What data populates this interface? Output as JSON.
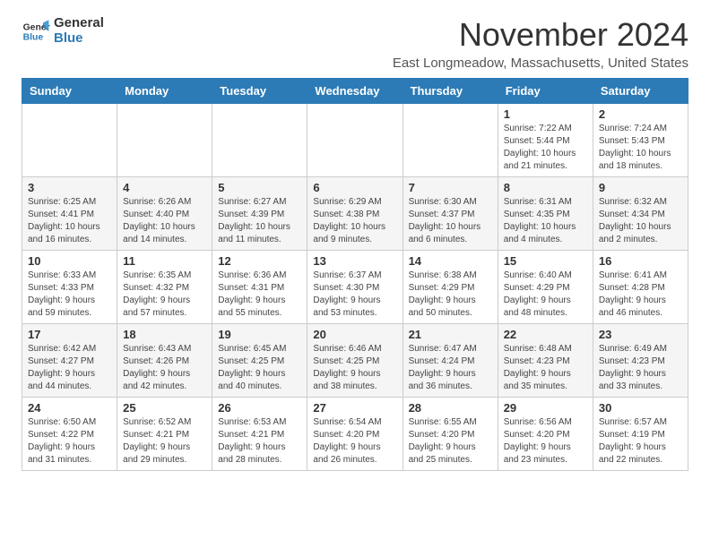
{
  "header": {
    "logo_general": "General",
    "logo_blue": "Blue",
    "month_title": "November 2024",
    "location": "East Longmeadow, Massachusetts, United States"
  },
  "days_of_week": [
    "Sunday",
    "Monday",
    "Tuesday",
    "Wednesday",
    "Thursday",
    "Friday",
    "Saturday"
  ],
  "weeks": [
    [
      {
        "num": "",
        "info": ""
      },
      {
        "num": "",
        "info": ""
      },
      {
        "num": "",
        "info": ""
      },
      {
        "num": "",
        "info": ""
      },
      {
        "num": "",
        "info": ""
      },
      {
        "num": "1",
        "info": "Sunrise: 7:22 AM\nSunset: 5:44 PM\nDaylight: 10 hours and 21 minutes."
      },
      {
        "num": "2",
        "info": "Sunrise: 7:24 AM\nSunset: 5:43 PM\nDaylight: 10 hours and 18 minutes."
      }
    ],
    [
      {
        "num": "3",
        "info": "Sunrise: 6:25 AM\nSunset: 4:41 PM\nDaylight: 10 hours and 16 minutes."
      },
      {
        "num": "4",
        "info": "Sunrise: 6:26 AM\nSunset: 4:40 PM\nDaylight: 10 hours and 14 minutes."
      },
      {
        "num": "5",
        "info": "Sunrise: 6:27 AM\nSunset: 4:39 PM\nDaylight: 10 hours and 11 minutes."
      },
      {
        "num": "6",
        "info": "Sunrise: 6:29 AM\nSunset: 4:38 PM\nDaylight: 10 hours and 9 minutes."
      },
      {
        "num": "7",
        "info": "Sunrise: 6:30 AM\nSunset: 4:37 PM\nDaylight: 10 hours and 6 minutes."
      },
      {
        "num": "8",
        "info": "Sunrise: 6:31 AM\nSunset: 4:35 PM\nDaylight: 10 hours and 4 minutes."
      },
      {
        "num": "9",
        "info": "Sunrise: 6:32 AM\nSunset: 4:34 PM\nDaylight: 10 hours and 2 minutes."
      }
    ],
    [
      {
        "num": "10",
        "info": "Sunrise: 6:33 AM\nSunset: 4:33 PM\nDaylight: 9 hours and 59 minutes."
      },
      {
        "num": "11",
        "info": "Sunrise: 6:35 AM\nSunset: 4:32 PM\nDaylight: 9 hours and 57 minutes."
      },
      {
        "num": "12",
        "info": "Sunrise: 6:36 AM\nSunset: 4:31 PM\nDaylight: 9 hours and 55 minutes."
      },
      {
        "num": "13",
        "info": "Sunrise: 6:37 AM\nSunset: 4:30 PM\nDaylight: 9 hours and 53 minutes."
      },
      {
        "num": "14",
        "info": "Sunrise: 6:38 AM\nSunset: 4:29 PM\nDaylight: 9 hours and 50 minutes."
      },
      {
        "num": "15",
        "info": "Sunrise: 6:40 AM\nSunset: 4:29 PM\nDaylight: 9 hours and 48 minutes."
      },
      {
        "num": "16",
        "info": "Sunrise: 6:41 AM\nSunset: 4:28 PM\nDaylight: 9 hours and 46 minutes."
      }
    ],
    [
      {
        "num": "17",
        "info": "Sunrise: 6:42 AM\nSunset: 4:27 PM\nDaylight: 9 hours and 44 minutes."
      },
      {
        "num": "18",
        "info": "Sunrise: 6:43 AM\nSunset: 4:26 PM\nDaylight: 9 hours and 42 minutes."
      },
      {
        "num": "19",
        "info": "Sunrise: 6:45 AM\nSunset: 4:25 PM\nDaylight: 9 hours and 40 minutes."
      },
      {
        "num": "20",
        "info": "Sunrise: 6:46 AM\nSunset: 4:25 PM\nDaylight: 9 hours and 38 minutes."
      },
      {
        "num": "21",
        "info": "Sunrise: 6:47 AM\nSunset: 4:24 PM\nDaylight: 9 hours and 36 minutes."
      },
      {
        "num": "22",
        "info": "Sunrise: 6:48 AM\nSunset: 4:23 PM\nDaylight: 9 hours and 35 minutes."
      },
      {
        "num": "23",
        "info": "Sunrise: 6:49 AM\nSunset: 4:23 PM\nDaylight: 9 hours and 33 minutes."
      }
    ],
    [
      {
        "num": "24",
        "info": "Sunrise: 6:50 AM\nSunset: 4:22 PM\nDaylight: 9 hours and 31 minutes."
      },
      {
        "num": "25",
        "info": "Sunrise: 6:52 AM\nSunset: 4:21 PM\nDaylight: 9 hours and 29 minutes."
      },
      {
        "num": "26",
        "info": "Sunrise: 6:53 AM\nSunset: 4:21 PM\nDaylight: 9 hours and 28 minutes."
      },
      {
        "num": "27",
        "info": "Sunrise: 6:54 AM\nSunset: 4:20 PM\nDaylight: 9 hours and 26 minutes."
      },
      {
        "num": "28",
        "info": "Sunrise: 6:55 AM\nSunset: 4:20 PM\nDaylight: 9 hours and 25 minutes."
      },
      {
        "num": "29",
        "info": "Sunrise: 6:56 AM\nSunset: 4:20 PM\nDaylight: 9 hours and 23 minutes."
      },
      {
        "num": "30",
        "info": "Sunrise: 6:57 AM\nSunset: 4:19 PM\nDaylight: 9 hours and 22 minutes."
      }
    ]
  ]
}
